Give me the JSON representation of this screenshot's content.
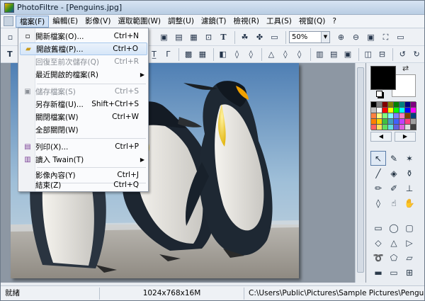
{
  "window": {
    "title": "PhotoFiltre - [Penguins.jpg]"
  },
  "menubar": [
    {
      "label": "檔案(F)"
    },
    {
      "label": "編輯(E)"
    },
    {
      "label": "影像(V)"
    },
    {
      "label": "選取範圍(W)"
    },
    {
      "label": "調整(U)"
    },
    {
      "label": "濾鏡(T)"
    },
    {
      "label": "檢視(R)"
    },
    {
      "label": "工具(S)"
    },
    {
      "label": "視窗(Q)"
    },
    {
      "label": "?"
    }
  ],
  "toolbar": {
    "zoom_value": "50%"
  },
  "file_menu": {
    "items": [
      {
        "label": "開新檔案(O)...",
        "shortcut": "Ctrl+N",
        "icon": "new-file-icon"
      },
      {
        "label": "開啟舊檔(P)...",
        "shortcut": "Ctrl+O",
        "icon": "open-folder-icon"
      },
      {
        "label": "回復至前次儲存(Q)",
        "shortcut": "Ctrl+R",
        "icon": ""
      },
      {
        "label": "最近開啟的檔案(R)",
        "shortcut": "",
        "icon": ""
      },
      {
        "label": "儲存檔案(S)",
        "shortcut": "Ctrl+S",
        "icon": "save-icon"
      },
      {
        "label": "另存新檔(U)...",
        "shortcut": "Shift+Ctrl+S",
        "icon": ""
      },
      {
        "label": "關閉檔案(W)",
        "shortcut": "Ctrl+W",
        "icon": ""
      },
      {
        "label": "全部關閉(W)",
        "shortcut": "",
        "icon": ""
      },
      {
        "label": "列印(X)...",
        "shortcut": "Ctrl+P",
        "icon": "printer-icon"
      },
      {
        "label": "讀入 Twain(T)",
        "shortcut": "",
        "icon": "scanner-icon"
      },
      {
        "label": "影像內容(Y)",
        "shortcut": "Ctrl+J",
        "icon": ""
      },
      {
        "label": "結束(Z)",
        "shortcut": "Ctrl+Q",
        "icon": ""
      }
    ]
  },
  "status": {
    "left": "就緒",
    "size": "1024x768x16M",
    "path": "C:\\Users\\Public\\Pictures\\Sample Pictures\\Penguins.jpg"
  },
  "colors": {
    "foreground": "#000000",
    "background": "#ffffff"
  }
}
